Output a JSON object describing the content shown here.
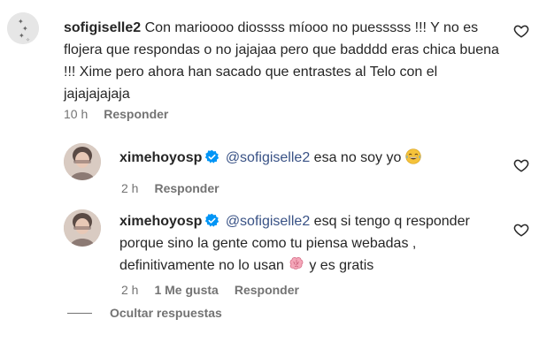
{
  "comments": [
    {
      "username": "sofigiselle2",
      "text": "Con marioooo diossss míooo no puesssss !!! Y no es flojera que respondas o no jajajaa pero que badddd eras chica buena !!! Xime pero ahora han sacado que entrastes al Telo con el jajajajajaja",
      "time": "10 h",
      "reply_label": "Responder"
    },
    {
      "username": "ximehoyosp",
      "mention": "@sofigiselle2",
      "text": "esa no soy yo",
      "time": "2 h",
      "reply_label": "Responder",
      "emoji": "tears-of-joy-emoji"
    },
    {
      "username": "ximehoyosp",
      "mention": "@sofigiselle2",
      "text_a": "esq si tengo q responder porque sino la gente como tu piensa webadas , definitivamente no lo usan",
      "text_b": "y es gratis",
      "time": "2 h",
      "likes_label": "1 Me gusta",
      "reply_label": "Responder",
      "emoji": "brain-emoji"
    }
  ],
  "hide_replies_label": "Ocultar respuestas",
  "colors": {
    "text": "#262626",
    "meta": "#737373",
    "verified": "#0095f6",
    "mention": "#385185"
  }
}
